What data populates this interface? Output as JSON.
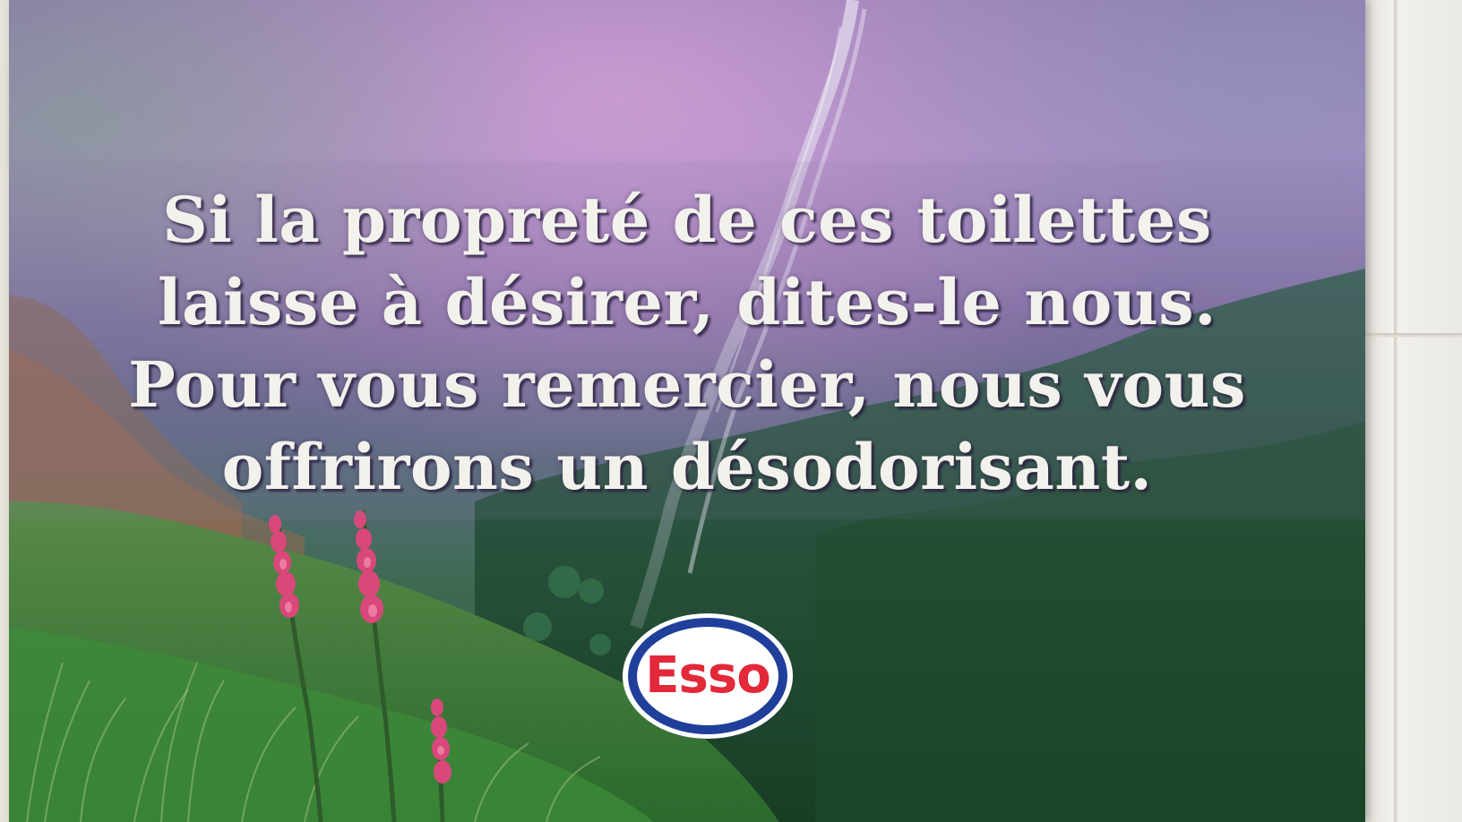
{
  "sign": {
    "lines": [
      "Si la propreté de ces toilettes",
      "laisse à désirer, dites-le nous.",
      "Pour vous remercier, nous vous",
      "offrirons un désodorisant."
    ],
    "logo": {
      "text": "Esso",
      "icon": "esso-oval-logo",
      "colors": {
        "text": "#e3283a",
        "ring": "#1f3f9a",
        "fill": "#ffffff"
      }
    }
  },
  "colors": {
    "sky_purple": "#8c6fb4",
    "foliage_green": "#2e6a44",
    "flower_pink": "#d8487a",
    "text_white": "#f3f1ec"
  }
}
